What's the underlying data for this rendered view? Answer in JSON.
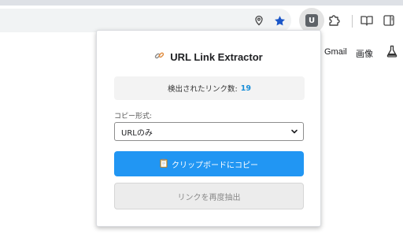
{
  "toolbar": {
    "icons": [
      "location-icon",
      "star-icon",
      "extension-u-icon",
      "puzzle-icon",
      "reading-mode-icon",
      "side-panel-icon"
    ],
    "extension_badge": "U"
  },
  "page": {
    "gmail_link": "Gmail",
    "images_link": "画像"
  },
  "popup": {
    "title": "URL Link Extractor",
    "title_icon": "link-icon",
    "count_label": "検出されたリンク数:",
    "count_value": "19",
    "format_label": "コピー形式:",
    "format_selected": "URLのみ",
    "copy_button_label": "クリップボードにコピー",
    "copy_button_icon": "clipboard-icon",
    "reextract_button_label": "リンクを再度抽出",
    "accent_color": "#2196f3",
    "count_color": "#1a8fd8"
  }
}
